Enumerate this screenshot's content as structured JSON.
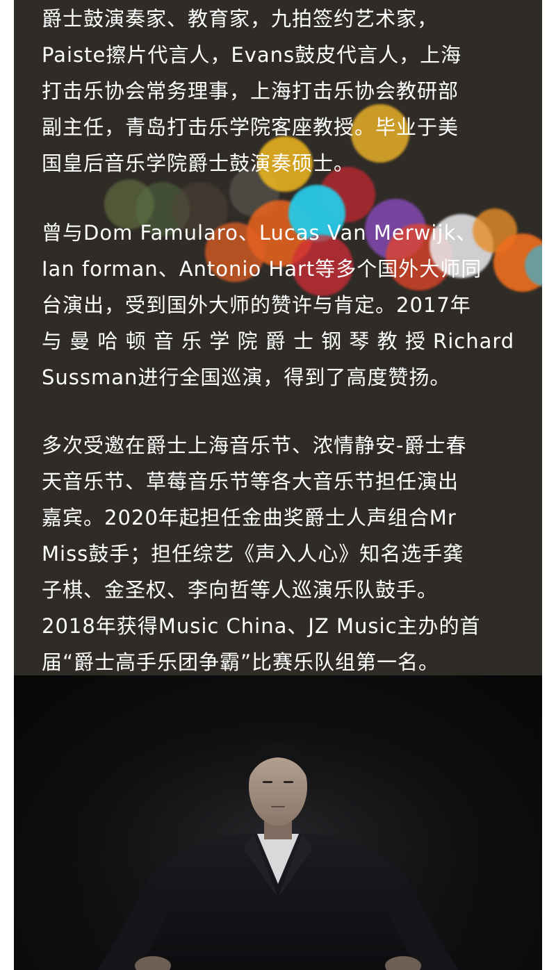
{
  "biography": {
    "paragraph_1": {
      "lines": [
        "爵士鼓演奏家、教育家，九拍签约艺术家，",
        "Paiste擦片代言人，Evans鼓皮代言人，上海",
        "打击乐协会常务理事，上海打击乐协会教研部",
        "副主任，青岛打击乐学院客座教授。毕业于美",
        "国皇后音乐学院爵士鼓演奏硕士。"
      ]
    },
    "paragraph_2": {
      "lines": [
        "曾与Dom Famularo、Lucas Van Merwijk、",
        "Ian forman、Antonio Hart等多个国外大师同",
        "台演出，受到国外大师的赞许与肯定。2017年",
        "与 曼 哈 顿 音 乐 学 院 爵 士 钢 琴 教 授 Richard",
        "Sussman进行全国巡演，得到了高度赞扬。"
      ]
    },
    "paragraph_3": {
      "lines": [
        "多次受邀在爵士上海音乐节、浓情静安-爵士春",
        "天音乐节、草莓音乐节等各大音乐节担任演出",
        "嘉宾。2020年起担任金曲奖爵士人声组合Mr",
        "Miss鼓手；担任综艺《声入人心》知名选手龚",
        "子棋、金圣权、李向哲等人巡演乐队鼓手。",
        "2018年获得Music China、JZ Music主办的首",
        "届“爵士高手乐团争霸”比赛乐队组第一名。"
      ]
    }
  },
  "colors": {
    "text_panel_background": "#2f2b27",
    "text_color": "#ffffff",
    "page_background": "#ffffff",
    "photo_background": "#0e0e10"
  },
  "photo": {
    "subject": "portrait-of-drummer-in-dark-suit"
  }
}
